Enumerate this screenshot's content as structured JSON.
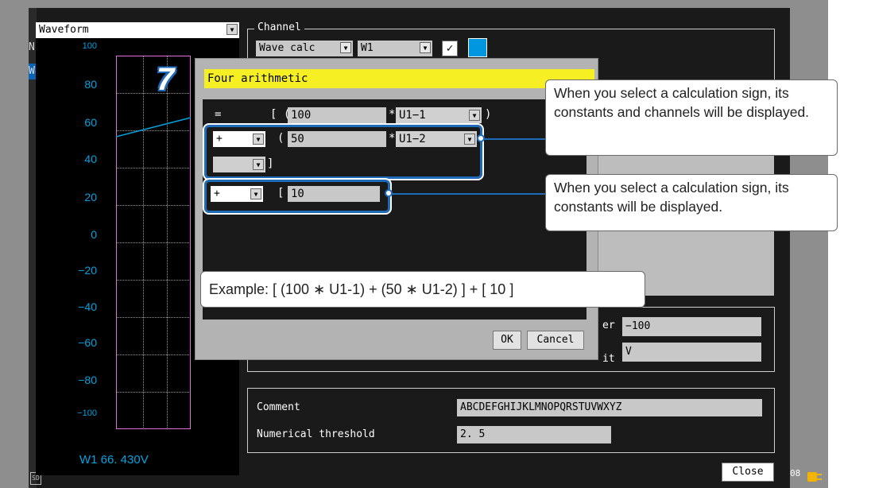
{
  "step_number": "7",
  "left_tabs": [
    "Nu",
    "Wa"
  ],
  "waveform": {
    "title": "Waveform",
    "readout": "W1 66. 430V",
    "trace_color": "#00a3e0",
    "frame_color": "#e46fd8",
    "axis_ticks": [
      "100",
      "80",
      "60",
      "40",
      "20",
      "0",
      "−20",
      "−40",
      "−60",
      "−80",
      "−100"
    ]
  },
  "channel": {
    "group_title": "Channel",
    "calc_type": "Wave calc",
    "channel_id": "W1",
    "display_checked": "✓",
    "color": "#0097e0"
  },
  "scaling": {
    "lower_label": "er",
    "lower_value": "−100",
    "unit_label": "it",
    "unit_value": "V"
  },
  "comment": {
    "label": "Comment",
    "value": "ABCDEFGHIJKLMNOPQRSTUVWXYZ"
  },
  "threshold": {
    "label": "Numerical threshold",
    "value": "2. 5"
  },
  "close_button": "Close",
  "status_fragment": "08",
  "dialog": {
    "title": "Four arithmetic",
    "row1": {
      "sign": "=",
      "open": "[ (",
      "constant": "100",
      "mult": "*",
      "channel": "U1−1",
      "close": ")"
    },
    "row2": {
      "sign": "+",
      "open": "(",
      "constant": "50",
      "mult": "*",
      "channel": "U1−2"
    },
    "row3": {
      "sign": "",
      "close": "]"
    },
    "row4": {
      "sign": "+",
      "open": "[",
      "constant": "10"
    },
    "ok": "OK",
    "cancel": "Cancel"
  },
  "callouts": {
    "sign_channels": "When you select a calculation sign, its constants and channels will be displayed.",
    "sign_constants": "When you select a calculation sign, its constants will be displayed.",
    "example": "Example: [ (100 ∗ U1-1) + (50 ∗ U1-2) ] + [ 10 ]"
  }
}
